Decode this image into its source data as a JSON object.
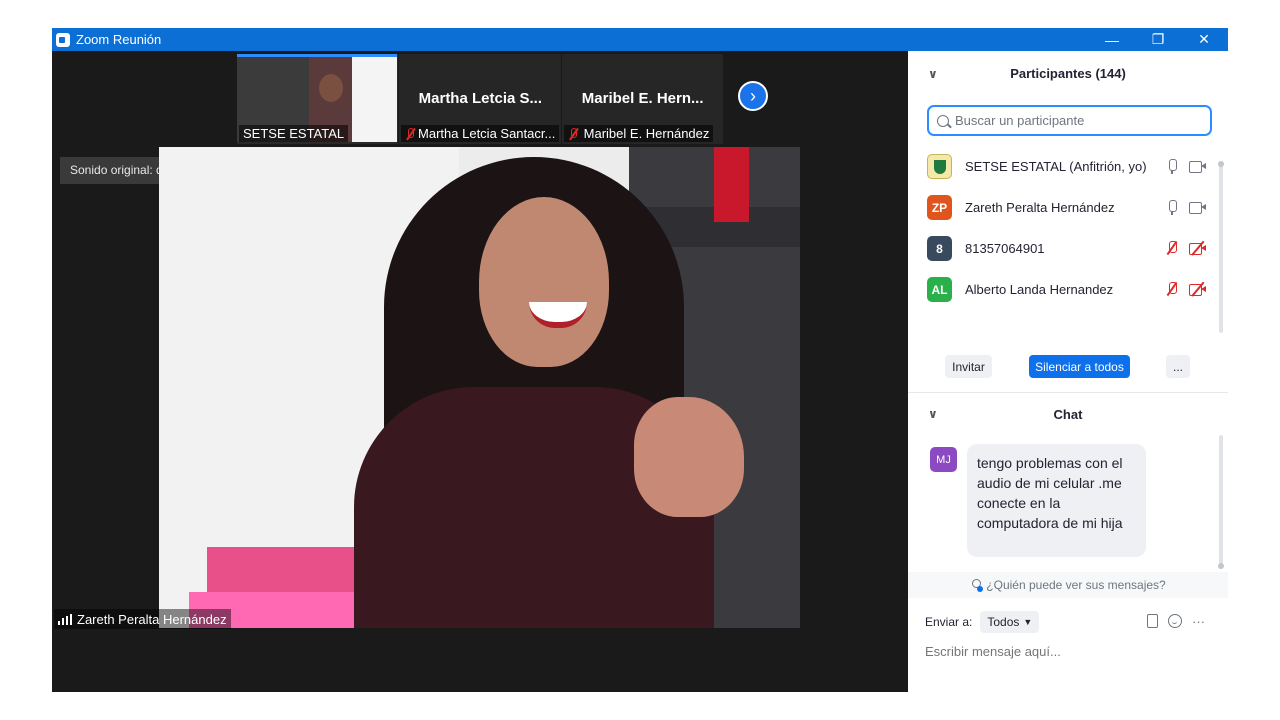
{
  "window": {
    "title": "Zoom Reunión"
  },
  "strip": {
    "tiles": [
      {
        "name": "SETSE ESTATAL",
        "show_big": false
      },
      {
        "big_name": "Martha Letcia S...",
        "name": "Martha Letcia Santacr..."
      },
      {
        "big_name": "Maribel E. Hern...",
        "name": "Maribel E. Hernández"
      }
    ],
    "next_icon": "chevron-right-icon"
  },
  "main_video": {
    "sound_label": "Sonido original: desactivado",
    "speaker_name": "Zareth Peralta Hernández"
  },
  "participants": {
    "header": "Participantes (144)",
    "search_placeholder": "Buscar un participante",
    "list": [
      {
        "initials": "",
        "name": "SETSE ESTATAL (Anfitrión, yo)",
        "color": "#f4e9a8",
        "mic": "on",
        "cam": "off-gray"
      },
      {
        "initials": "ZP",
        "name": "Zareth Peralta Hernández",
        "color": "#e0541e",
        "mic": "on",
        "cam": "off-gray"
      },
      {
        "initials": "8",
        "name": "81357064901",
        "color": "#3a4a5e",
        "mic": "muted",
        "cam": "muted"
      },
      {
        "initials": "AL",
        "name": "Alberto Landa Hernandez",
        "color": "#2ab04a",
        "mic": "muted",
        "cam": "muted"
      }
    ],
    "invite_label": "Invitar",
    "mute_all_label": "Silenciar a todos",
    "more_label": "..."
  },
  "chat": {
    "header": "Chat",
    "messages": [
      {
        "initials": "MJ",
        "text": "tengo problemas con el audio de mi celular .me conecte en la computadora de mi hija"
      }
    ],
    "who_can_see": "¿Quién puede ver sus mensajes?",
    "send_to_label": "Enviar a:",
    "recipient": "Todos",
    "compose_placeholder": "Escribir mensaje aquí...",
    "more_tools": "···"
  },
  "colors": {
    "titlebar": "#0b6fd6",
    "accent": "#0e71eb",
    "muted_red": "#e02828"
  }
}
